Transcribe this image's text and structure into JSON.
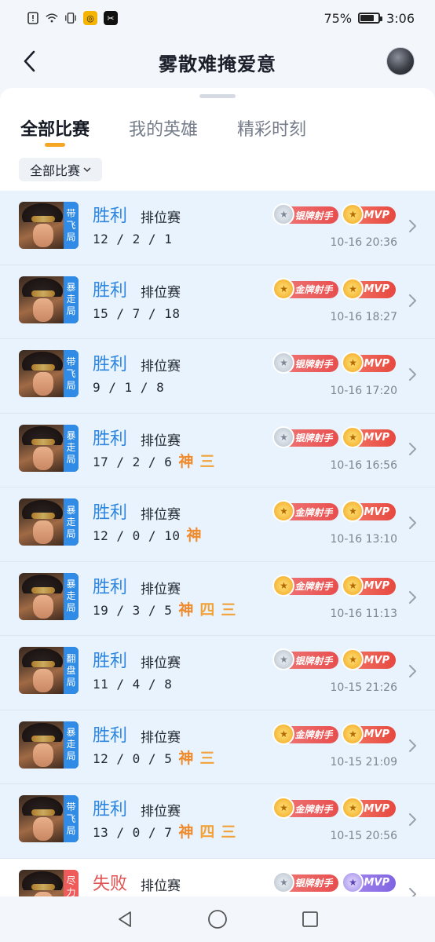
{
  "status_bar": {
    "battery_text": "75%",
    "battery_level": 0.75,
    "time": "3:06",
    "icons": [
      "alert-icon",
      "wifi-icon",
      "vibrate-icon",
      "app-icon-orange",
      "app-icon-capcut"
    ]
  },
  "nav": {
    "title": "雾散难掩爱意",
    "back_icon": "back-arrow-icon",
    "avatar": "user-avatar"
  },
  "tabs": [
    {
      "label": "全部比赛",
      "active": true
    },
    {
      "label": "我的英雄",
      "active": false
    },
    {
      "label": "精彩时刻",
      "active": false
    }
  ],
  "filter": {
    "label": "全部比赛",
    "icon": "chevron-down-icon"
  },
  "matches": [
    {
      "result": "胜利",
      "mode": "排位赛",
      "kda": "12 / 2 / 1",
      "tag": "带飞局",
      "tag_lines": [
        "带",
        "飞",
        "局"
      ],
      "tier": "银牌射手",
      "tier_type": "silver",
      "mvp": "MVP",
      "time": "10-16 20:36",
      "marks": [],
      "outcome": "win"
    },
    {
      "result": "胜利",
      "mode": "排位赛",
      "kda": "15 / 7 / 18",
      "tag": "暴走局",
      "tag_lines": [
        "暴",
        "走",
        "局"
      ],
      "tier": "金牌射手",
      "tier_type": "gold",
      "mvp": "MVP",
      "time": "10-16 18:27",
      "marks": [],
      "outcome": "win"
    },
    {
      "result": "胜利",
      "mode": "排位赛",
      "kda": "9 / 1 / 8",
      "tag": "带飞局",
      "tag_lines": [
        "带",
        "飞",
        "局"
      ],
      "tier": "银牌射手",
      "tier_type": "silver",
      "mvp": "MVP",
      "time": "10-16 17:20",
      "marks": [],
      "outcome": "win"
    },
    {
      "result": "胜利",
      "mode": "排位赛",
      "kda": "17 / 2 / 6",
      "tag": "暴走局",
      "tag_lines": [
        "暴",
        "走",
        "局"
      ],
      "tier": "银牌射手",
      "tier_type": "silver",
      "mvp": "MVP",
      "time": "10-16 16:56",
      "marks": [
        "神",
        "三"
      ],
      "outcome": "win"
    },
    {
      "result": "胜利",
      "mode": "排位赛",
      "kda": "12 / 0 / 10",
      "tag": "暴走局",
      "tag_lines": [
        "暴",
        "走",
        "局"
      ],
      "tier": "金牌射手",
      "tier_type": "gold",
      "mvp": "MVP",
      "time": "10-16 13:10",
      "marks": [
        "神"
      ],
      "outcome": "win"
    },
    {
      "result": "胜利",
      "mode": "排位赛",
      "kda": "19 / 3 / 5",
      "tag": "暴走局",
      "tag_lines": [
        "暴",
        "走",
        "局"
      ],
      "tier": "金牌射手",
      "tier_type": "gold",
      "mvp": "MVP",
      "time": "10-16 11:13",
      "marks": [
        "神",
        "四",
        "三"
      ],
      "outcome": "win"
    },
    {
      "result": "胜利",
      "mode": "排位赛",
      "kda": "11 / 4 / 8",
      "tag": "翻盘局",
      "tag_lines": [
        "翻",
        "盘",
        "局"
      ],
      "tier": "银牌射手",
      "tier_type": "silver",
      "mvp": "MVP",
      "time": "10-15 21:26",
      "marks": [],
      "outcome": "win"
    },
    {
      "result": "胜利",
      "mode": "排位赛",
      "kda": "12 / 0 / 5",
      "tag": "暴走局",
      "tag_lines": [
        "暴",
        "走",
        "局"
      ],
      "tier": "金牌射手",
      "tier_type": "gold",
      "mvp": "MVP",
      "time": "10-15 21:09",
      "marks": [
        "神",
        "三"
      ],
      "outcome": "win"
    },
    {
      "result": "胜利",
      "mode": "排位赛",
      "kda": "13 / 0 / 7",
      "tag": "带飞局",
      "tag_lines": [
        "带",
        "飞",
        "局"
      ],
      "tier": "金牌射手",
      "tier_type": "gold",
      "mvp": "MVP",
      "time": "10-15 20:56",
      "marks": [
        "神",
        "四",
        "三"
      ],
      "outcome": "win"
    },
    {
      "result": "失败",
      "mode": "排位赛",
      "kda": "",
      "tag": "尽力局",
      "tag_lines": [
        "尽",
        "力",
        "局"
      ],
      "tier": "银牌射手",
      "tier_type": "silver",
      "mvp": "MVP",
      "time": "",
      "marks": [],
      "outcome": "loss"
    }
  ],
  "system_nav": [
    "back-triangle-icon",
    "home-circle-icon",
    "recents-square-icon"
  ]
}
